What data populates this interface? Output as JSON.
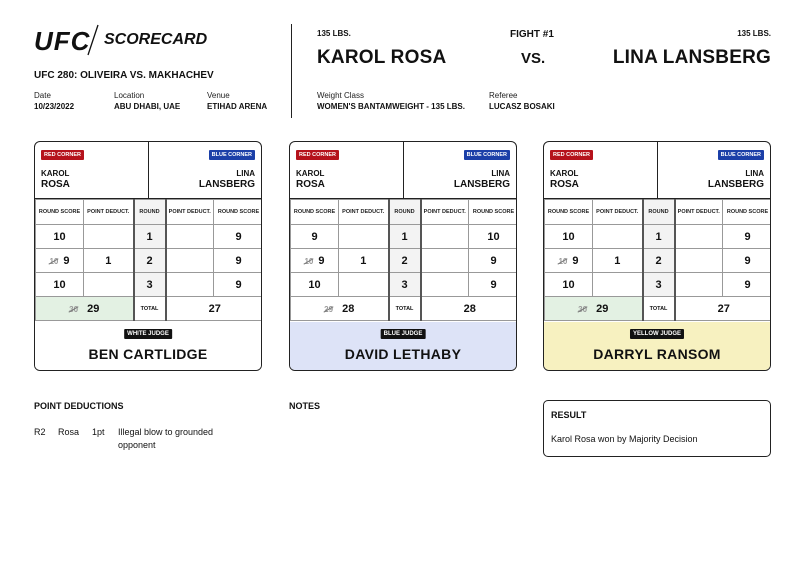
{
  "header": {
    "logo": "UFC",
    "scorecard_word": "SCORECARD",
    "event": "UFC 280: OLIVEIRA VS. MAKHACHEV",
    "date_label": "Date",
    "date": "10/23/2022",
    "location_label": "Location",
    "location": "ABU DHABI, UAE",
    "venue_label": "Venue",
    "venue": "ETIHAD ARENA"
  },
  "fight": {
    "left_weight": "135 LBS.",
    "right_weight": "135 LBS.",
    "fight_number": "FIGHT #1",
    "vs": "VS.",
    "left_fighter": "KAROL ROSA",
    "right_fighter": "LINA LANSBERG",
    "weight_class_label": "Weight Class",
    "weight_class": "WOMEN'S BANTAMWEIGHT - 135 LBS.",
    "referee_label": "Referee",
    "referee": "LUCASZ BOSAKI"
  },
  "corners": {
    "red_label": "RED CORNER",
    "blue_label": "BLUE CORNER",
    "red_first": "KAROL",
    "red_last": "ROSA",
    "blue_first": "LINA",
    "blue_last": "LANSBERG"
  },
  "columns": {
    "round_score": "ROUND SCORE",
    "point_deduct": "POINT DEDUCT.",
    "round": "ROUND",
    "total": "TOTAL"
  },
  "cards": [
    {
      "badge": "WHITE JUDGE",
      "judge": "BEN CARTLIDGE",
      "color": "#ffffff",
      "total_bg": "#e3f1e3",
      "rows": [
        {
          "red_old": "",
          "red": "10",
          "red_ded": "",
          "round": "1",
          "blue_ded": "",
          "blue": "9"
        },
        {
          "red_old": "10",
          "red": "9",
          "red_ded": "1",
          "round": "2",
          "blue_ded": "",
          "blue": "9"
        },
        {
          "red_old": "",
          "red": "10",
          "red_ded": "",
          "round": "3",
          "blue_ded": "",
          "blue": "9"
        }
      ],
      "red_total_old": "30",
      "red_total": "29",
      "blue_total": "27"
    },
    {
      "badge": "BLUE JUDGE",
      "judge": "DAVID LETHABY",
      "color": "#dde3f7",
      "total_bg": "#ffffff",
      "rows": [
        {
          "red_old": "",
          "red": "9",
          "red_ded": "",
          "round": "1",
          "blue_ded": "",
          "blue": "10"
        },
        {
          "red_old": "10",
          "red": "9",
          "red_ded": "1",
          "round": "2",
          "blue_ded": "",
          "blue": "9"
        },
        {
          "red_old": "",
          "red": "10",
          "red_ded": "",
          "round": "3",
          "blue_ded": "",
          "blue": "9"
        }
      ],
      "red_total_old": "29",
      "red_total": "28",
      "blue_total": "28"
    },
    {
      "badge": "YELLOW JUDGE",
      "judge": "DARRYL RANSOM",
      "color": "#f7f1c0",
      "total_bg": "#e3f1e3",
      "rows": [
        {
          "red_old": "",
          "red": "10",
          "red_ded": "",
          "round": "1",
          "blue_ded": "",
          "blue": "9"
        },
        {
          "red_old": "10",
          "red": "9",
          "red_ded": "1",
          "round": "2",
          "blue_ded": "",
          "blue": "9"
        },
        {
          "red_old": "",
          "red": "10",
          "red_ded": "",
          "round": "3",
          "blue_ded": "",
          "blue": "9"
        }
      ],
      "red_total_old": "30",
      "red_total": "29",
      "blue_total": "27"
    }
  ],
  "deductions": {
    "title": "POINT DEDUCTIONS",
    "round": "R2",
    "fighter": "Rosa",
    "points": "1pt",
    "reason_line1": "Illegal blow to grounded",
    "reason_line2": "opponent"
  },
  "notes": {
    "title": "NOTES"
  },
  "result": {
    "title": "RESULT",
    "text": "Karol Rosa won by Majority Decision"
  }
}
